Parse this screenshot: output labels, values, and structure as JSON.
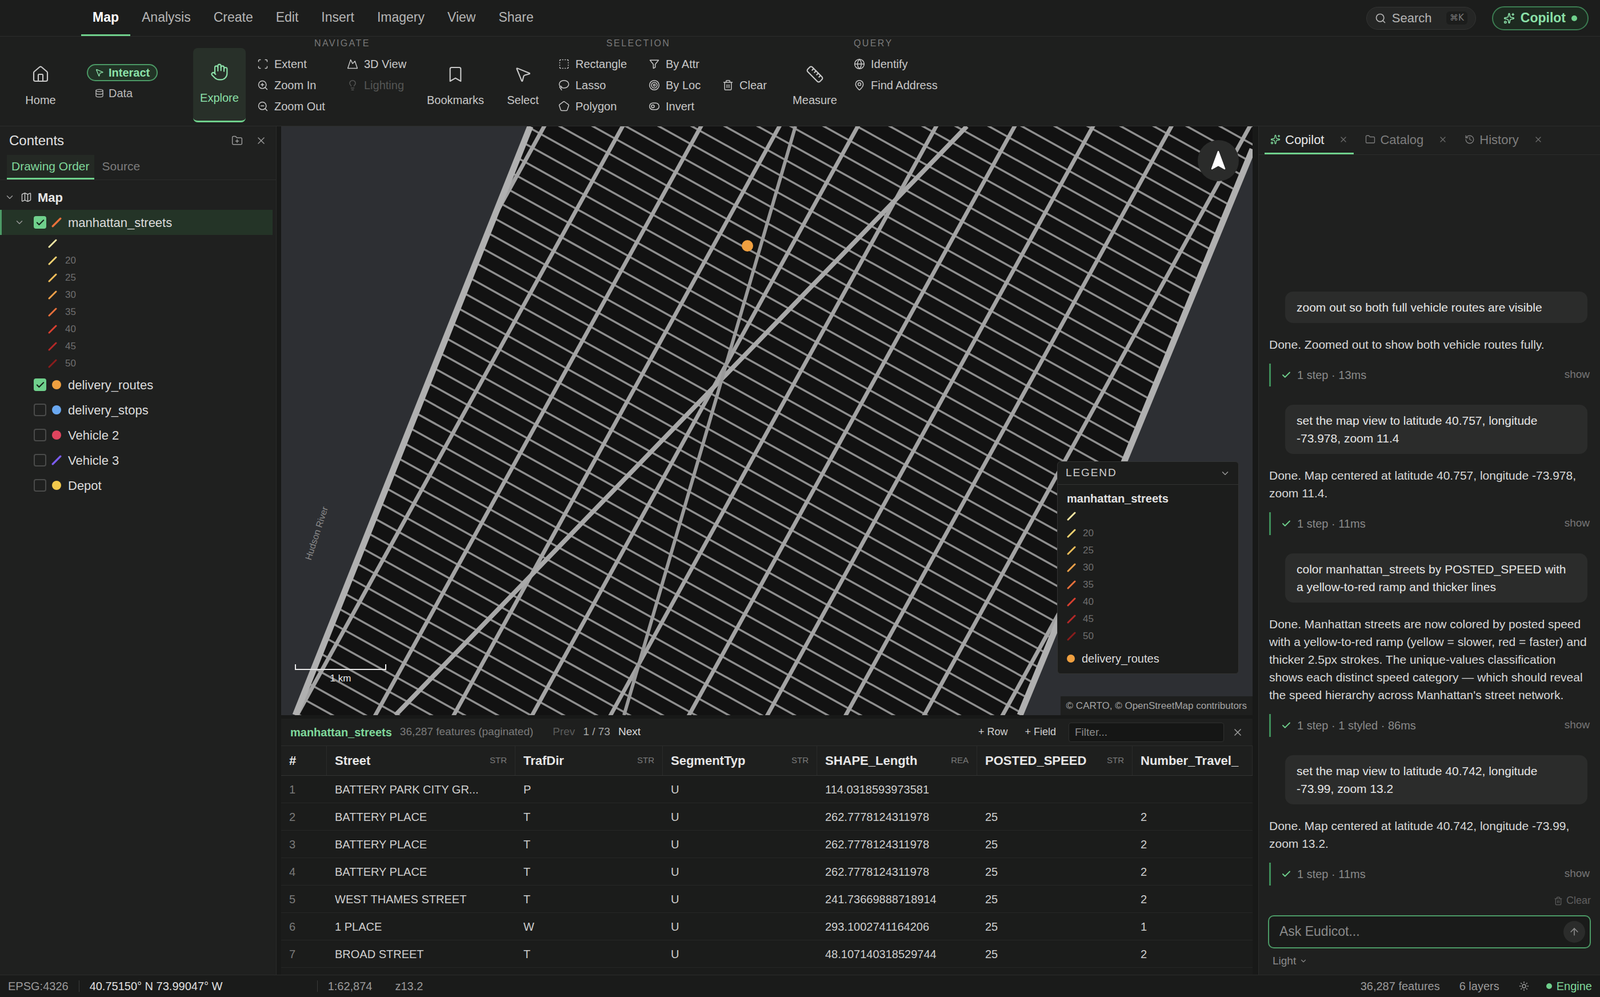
{
  "menu": {
    "items": [
      {
        "label": "Map",
        "selected": true
      },
      {
        "label": "Analysis",
        "selected": false
      },
      {
        "label": "Create",
        "selected": false
      },
      {
        "label": "Edit",
        "selected": false
      },
      {
        "label": "Insert",
        "selected": false
      },
      {
        "label": "Imagery",
        "selected": false
      },
      {
        "label": "View",
        "selected": false
      },
      {
        "label": "Share",
        "selected": false
      }
    ]
  },
  "search": {
    "label": "Search",
    "shortcut": "⌘K"
  },
  "copilot_button": {
    "label": "Copilot",
    "online": true
  },
  "ribbon": {
    "home": "Home",
    "modes": [
      {
        "label": "Interact",
        "selected": true
      },
      {
        "label": "Data",
        "selected": false
      }
    ],
    "explore": {
      "label": "Explore",
      "selected": true
    },
    "navigate": {
      "title": "NAVIGATE",
      "column1": [
        {
          "label": "Extent",
          "disabled": false
        },
        {
          "label": "Zoom In",
          "disabled": false
        },
        {
          "label": "Zoom Out",
          "disabled": false
        }
      ],
      "column2": [
        {
          "label": "3D View",
          "disabled": false
        },
        {
          "label": "Lighting",
          "disabled": true
        }
      ]
    },
    "bookmarks": "Bookmarks",
    "select": "Select",
    "selection": {
      "title": "SELECTION",
      "column1": [
        "Rectangle",
        "Lasso",
        "Polygon"
      ],
      "column2": [
        "By Attr",
        "By Loc",
        "Invert"
      ],
      "clear": "Clear"
    },
    "measure": "Measure",
    "query": {
      "title": "QUERY",
      "items": [
        "Identify",
        "Find Address"
      ]
    }
  },
  "contents": {
    "title": "Contents",
    "tabs": [
      {
        "label": "Drawing Order",
        "selected": true
      },
      {
        "label": "Source",
        "selected": false
      }
    ],
    "root": {
      "label": "Map",
      "expanded": true
    },
    "layers": [
      {
        "name": "manhattan_streets",
        "checked": true,
        "selected": true,
        "expanded": true,
        "kind": "line",
        "color": "#e8703a",
        "legend": [
          {
            "label": "",
            "color": "#f3e6a3"
          },
          {
            "label": "20",
            "color": "#f2d271"
          },
          {
            "label": "25",
            "color": "#f0bd5a"
          },
          {
            "label": "30",
            "color": "#eda04a"
          },
          {
            "label": "35",
            "color": "#e6703c"
          },
          {
            "label": "40",
            "color": "#d94030"
          },
          {
            "label": "45",
            "color": "#b52828"
          },
          {
            "label": "50",
            "color": "#8a1c1c"
          }
        ]
      },
      {
        "name": "delivery_routes",
        "checked": true,
        "selected": false,
        "expanded": false,
        "kind": "dot",
        "color": "#f0a040",
        "legend": []
      },
      {
        "name": "delivery_stops",
        "checked": false,
        "selected": false,
        "expanded": false,
        "kind": "dot",
        "color": "#6aa8f0",
        "legend": []
      },
      {
        "name": "Vehicle 2",
        "checked": false,
        "selected": false,
        "expanded": false,
        "kind": "dot",
        "color": "#e0445e",
        "legend": []
      },
      {
        "name": "Vehicle 3",
        "checked": false,
        "selected": false,
        "expanded": false,
        "kind": "line",
        "color": "#7b5cf0",
        "legend": []
      },
      {
        "name": "Depot",
        "checked": false,
        "selected": false,
        "expanded": false,
        "kind": "dot",
        "color": "#f2c94c",
        "legend": []
      }
    ]
  },
  "map": {
    "water_label": "Hudson River",
    "scale": "1 km",
    "attribution": "© CARTO, © OpenStreetMap contributors",
    "route_point": {
      "color": "#f0a040"
    },
    "legend": {
      "title": "LEGEND",
      "expanded": true,
      "layers": [
        {
          "name": "manhattan_streets",
          "kind": "classes",
          "color": "",
          "classes": [
            {
              "label": "",
              "color": "#f3e6a3"
            },
            {
              "label": "20",
              "color": "#f2d271"
            },
            {
              "label": "25",
              "color": "#f0bd5a"
            },
            {
              "label": "30",
              "color": "#eda04a"
            },
            {
              "label": "35",
              "color": "#e6703c"
            },
            {
              "label": "40",
              "color": "#d94030"
            },
            {
              "label": "45",
              "color": "#b52828"
            },
            {
              "label": "50",
              "color": "#8a1c1c"
            }
          ]
        },
        {
          "name": "delivery_routes",
          "kind": "dot",
          "color": "#f0a040",
          "classes": []
        }
      ]
    }
  },
  "table": {
    "layer": "manhattan_streets",
    "count": "36,287 features (paginated)",
    "pager": {
      "prev": {
        "label": "Prev",
        "disabled": true
      },
      "page": "1 / 73",
      "next": {
        "label": "Next",
        "disabled": false
      }
    },
    "actions": [
      "+ Row",
      "+ Field"
    ],
    "filter": {
      "placeholder": "Filter..."
    },
    "columns": [
      {
        "name": "#",
        "type": ""
      },
      {
        "name": "Street",
        "type": "STR"
      },
      {
        "name": "TrafDir",
        "type": "STR"
      },
      {
        "name": "SegmentTyp",
        "type": "STR"
      },
      {
        "name": "SHAPE_Length",
        "type": "REA"
      },
      {
        "name": "POSTED_SPEED",
        "type": "STR"
      },
      {
        "name": "Number_Travel_",
        "type": ""
      }
    ],
    "rows": [
      [
        "1",
        "BATTERY PARK CITY GR...",
        "P",
        "U",
        "114.0318593973581",
        "",
        ""
      ],
      [
        "2",
        "BATTERY PLACE",
        "T",
        "U",
        "262.7778124311978",
        "25",
        "2"
      ],
      [
        "3",
        "BATTERY PLACE",
        "T",
        "U",
        "262.7778124311978",
        "25",
        "2"
      ],
      [
        "4",
        "BATTERY PLACE",
        "T",
        "U",
        "262.7778124311978",
        "25",
        "2"
      ],
      [
        "5",
        "WEST THAMES STREET",
        "T",
        "U",
        "241.73669888718914",
        "25",
        "2"
      ],
      [
        "6",
        "1 PLACE",
        "W",
        "U",
        "293.1002741164206",
        "25",
        "1"
      ],
      [
        "7",
        "BROAD STREET",
        "T",
        "U",
        "48.107140318529744",
        "25",
        "2"
      ]
    ]
  },
  "copilot": {
    "tabs": [
      {
        "label": "Copilot",
        "selected": true
      },
      {
        "label": "Catalog",
        "selected": false
      },
      {
        "label": "History",
        "selected": false
      }
    ],
    "messages": [
      {
        "kind": "user",
        "text": "zoom out so both full vehicle routes are visible",
        "steps": "",
        "action": ""
      },
      {
        "kind": "assistant",
        "text": "Done. Zoomed out to show both vehicle routes fully.",
        "steps": "1 step · 13ms",
        "action": "show"
      },
      {
        "kind": "user",
        "text": "set the map view to latitude 40.757, longitude -73.978, zoom 11.4",
        "steps": "",
        "action": ""
      },
      {
        "kind": "assistant",
        "text": "Done. Map centered at latitude 40.757, longitude -73.978, zoom 11.4.",
        "steps": "1 step · 11ms",
        "action": "show"
      },
      {
        "kind": "user",
        "text": "color manhattan_streets by POSTED_SPEED with a yellow-to-red ramp and thicker lines",
        "steps": "",
        "action": ""
      },
      {
        "kind": "assistant",
        "text": "Done. Manhattan streets are now colored by posted speed with a yellow-to-red ramp (yellow = slower, red = faster) and thicker 2.5px strokes. The unique-values classification shows each distinct speed category — which should reveal the speed hierarchy across Manhattan's street network.",
        "steps": "1 step · 1 styled · 86ms",
        "action": "show"
      },
      {
        "kind": "user",
        "text": "set the map view to latitude 40.742, longitude -73.99, zoom 13.2",
        "steps": "",
        "action": ""
      },
      {
        "kind": "assistant",
        "text": "Done. Map centered at latitude 40.742, longitude -73.99, zoom 13.2.",
        "steps": "1 step · 11ms",
        "action": "show"
      }
    ],
    "clear": "Clear",
    "input": {
      "placeholder": "Ask Eudicot..."
    },
    "mode": "Light"
  },
  "status_bar": {
    "crs": "EPSG:4326",
    "coords": "40.75150° N 73.99047° W",
    "scale": "1:62,874",
    "zoom": "z13.2",
    "features": "36,287 features",
    "layers": "6 layers",
    "engine": {
      "label": "Engine",
      "on": true
    }
  }
}
